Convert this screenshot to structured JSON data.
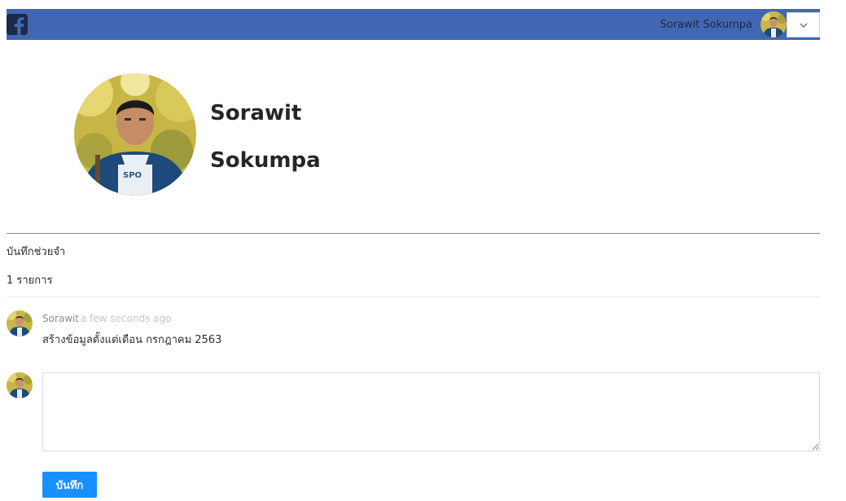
{
  "header": {
    "user_name": "Sorawit Sokumpa",
    "logo_icon": "facebook-icon",
    "dropdown_icon": "chevron-down-icon",
    "bar_color": "#4267b2"
  },
  "profile": {
    "first_name": "Sorawit",
    "last_name": "Sokumpa"
  },
  "notes": {
    "title": "บันทึกช่วยจำ",
    "count_label": "1 รายการ"
  },
  "comments": [
    {
      "author": "Sorawit",
      "time": "a few seconds ago",
      "text": "สร้างข้อมูลตั้งแต่เดือน กรกฎาคม 2563"
    }
  ],
  "editor": {
    "value": "",
    "submit_label": "บันทึก",
    "button_color": "#1890ff"
  }
}
